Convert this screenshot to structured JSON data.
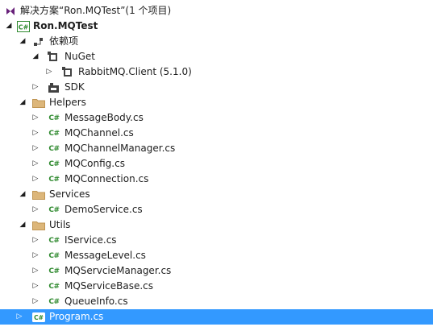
{
  "solution": {
    "label": "解决方案“Ron.MQTest”(1 个项目)"
  },
  "project": {
    "label": "Ron.MQTest",
    "icon": "csharp-project-icon"
  },
  "dependencies": {
    "label": "依赖项",
    "nuget": {
      "label": "NuGet",
      "package": "RabbitMQ.Client (5.1.0)"
    },
    "sdk": {
      "label": "SDK"
    }
  },
  "helpers": {
    "label": "Helpers",
    "files": [
      "MessageBody.cs",
      "MQChannel.cs",
      "MQChannelManager.cs",
      "MQConfig.cs",
      "MQConnection.cs"
    ]
  },
  "services": {
    "label": "Services",
    "files": [
      "DemoService.cs"
    ]
  },
  "utils": {
    "label": "Utils",
    "files": [
      "IService.cs",
      "MessageLevel.cs",
      "MQServcieManager.cs",
      "MQServiceBase.cs",
      "QueueInfo.cs"
    ]
  },
  "program": {
    "label": "Program.cs"
  },
  "colors": {
    "selection": "#3399ff",
    "folder": "#dcb67a",
    "csharp": "#2f8a2f"
  }
}
